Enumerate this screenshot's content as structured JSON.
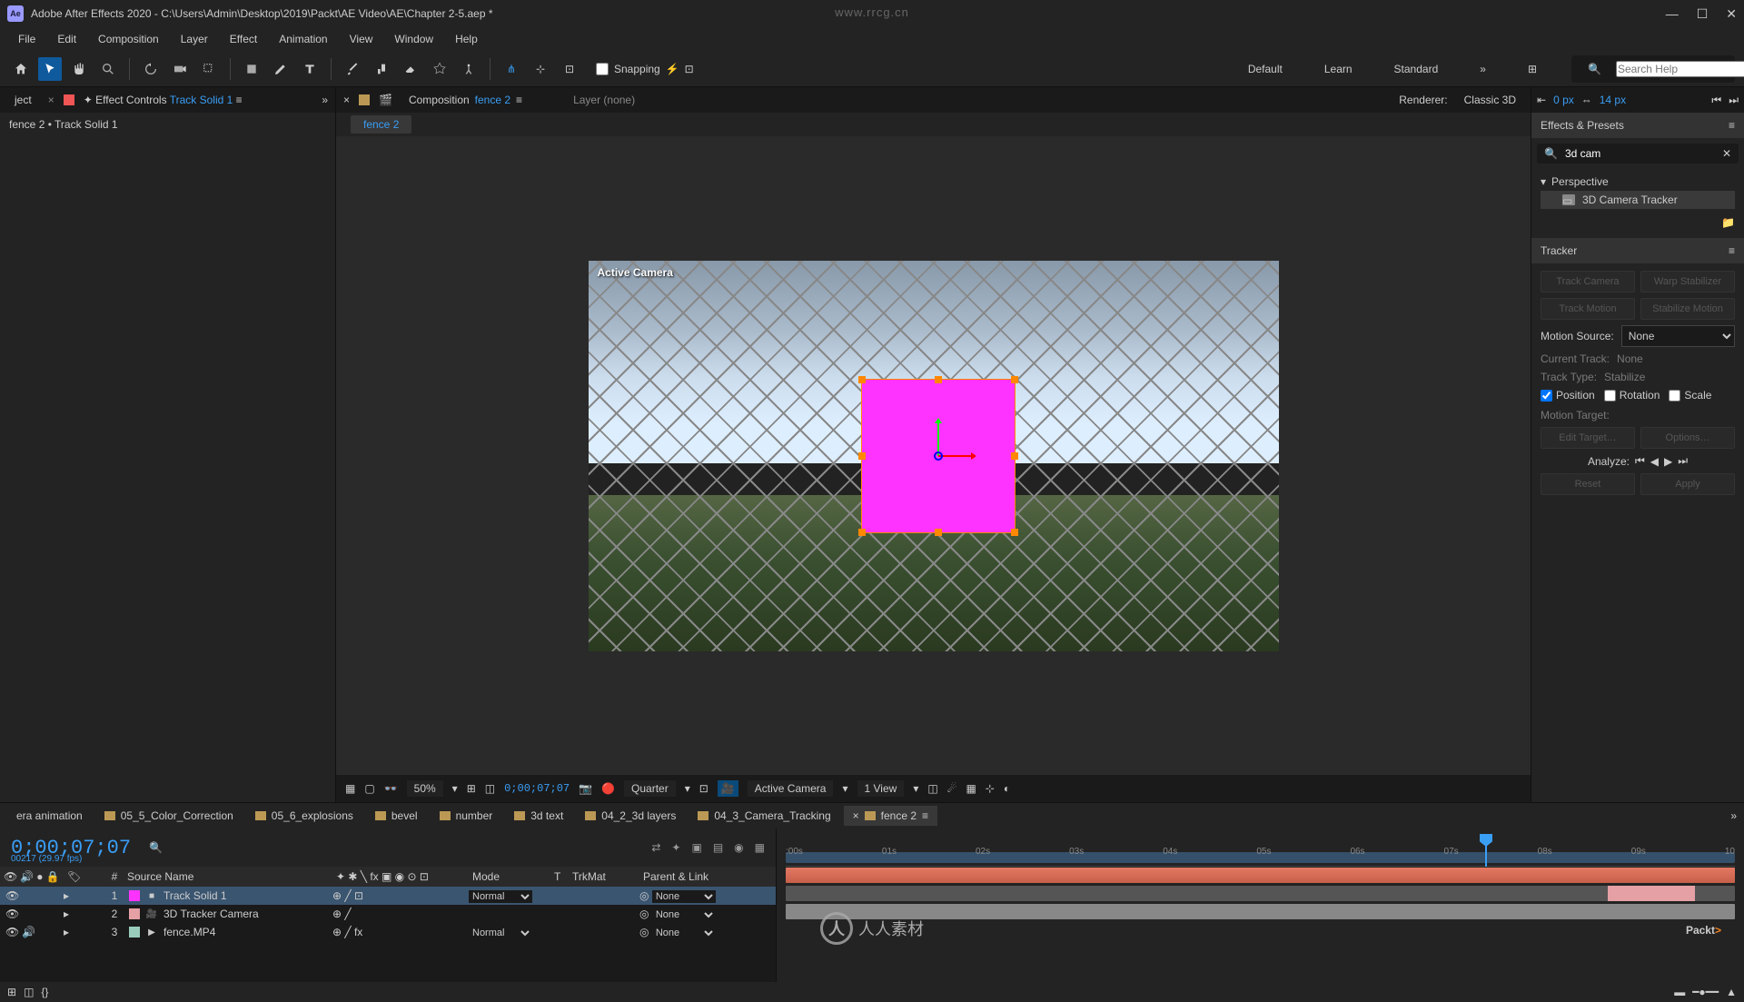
{
  "title": "Adobe After Effects 2020 - C:\\Users\\Admin\\Desktop\\2019\\Packt\\AE Video\\AE\\Chapter 2-5.aep *",
  "url_watermark": "www.rrcg.cn",
  "menu": [
    "File",
    "Edit",
    "Composition",
    "Layer",
    "Effect",
    "Animation",
    "View",
    "Window",
    "Help"
  ],
  "toolbar": {
    "snapping_label": "Snapping",
    "workspaces": [
      "Default",
      "Learn",
      "Standard"
    ],
    "search_placeholder": "Search Help"
  },
  "align_bar": {
    "px1": "0 px",
    "px2": "14 px"
  },
  "left_panel": {
    "tab_label_prefix": "ject",
    "effect_controls": "Effect Controls",
    "effect_target": "Track Solid 1",
    "breadcrumb": "fence 2 • Track Solid 1"
  },
  "comp_panel": {
    "tab_label": "Composition",
    "comp_name": "fence 2",
    "layer_none": "Layer (none)",
    "renderer_label": "Renderer:",
    "renderer_value": "Classic 3D",
    "active_tab": "fence 2",
    "camera_label": "Active Camera"
  },
  "viewer_footer": {
    "zoom": "50%",
    "timecode": "0;00;07;07",
    "res": "Quarter",
    "camera": "Active Camera",
    "views": "1 View"
  },
  "effects_presets": {
    "title": "Effects & Presets",
    "search": "3d cam",
    "group": "Perspective",
    "item": "3D Camera Tracker"
  },
  "tracker": {
    "title": "Tracker",
    "track_camera": "Track Camera",
    "warp": "Warp Stabilizer",
    "track_motion": "Track Motion",
    "stabilize_motion": "Stabilize Motion",
    "motion_source_label": "Motion Source:",
    "motion_source_value": "None",
    "current_track": "Current Track:",
    "current_track_value": "None",
    "track_type": "Track Type:",
    "track_type_value": "Stabilize",
    "position": "Position",
    "rotation": "Rotation",
    "scale": "Scale",
    "motion_target": "Motion Target:",
    "edit_target": "Edit Target…",
    "options": "Options…",
    "analyze": "Analyze:",
    "reset": "Reset",
    "apply": "Apply"
  },
  "timeline": {
    "tabs": [
      "era animation",
      "05_5_Color_Correction",
      "05_6_explosions",
      "bevel",
      "number",
      "3d text",
      "04_2_3d layers",
      "04_3_Camera_Tracking",
      "fence 2"
    ],
    "active_tab": "fence 2",
    "timecode": "0;00;07;07",
    "fps_frame": "00217 (29.97 fps)",
    "columns": {
      "num": "#",
      "source": "Source Name",
      "mode": "Mode",
      "t": "T",
      "trkmat": "TrkMat",
      "parent": "Parent & Link"
    },
    "ruler": [
      ":00s",
      "01s",
      "02s",
      "03s",
      "04s",
      "05s",
      "06s",
      "07s",
      "08s",
      "09s",
      "10"
    ],
    "layers": [
      {
        "num": "1",
        "color": "#ff33ff",
        "name": "Track Solid 1",
        "mode": "Normal",
        "parent": "None",
        "type": "solid",
        "selected": true,
        "eye": true,
        "threed": true
      },
      {
        "num": "2",
        "color": "#e5a0a5",
        "name": "3D Tracker Camera",
        "mode": "",
        "parent": "None",
        "type": "camera",
        "selected": false,
        "eye": true,
        "threed": false
      },
      {
        "num": "3",
        "color": "#99ccbb",
        "name": "fence.MP4",
        "mode": "Normal",
        "parent": "None",
        "type": "video",
        "selected": false,
        "eye": true,
        "audio": true,
        "fx": true
      }
    ]
  },
  "brand": "Packt",
  "center_logo": "人人素材"
}
